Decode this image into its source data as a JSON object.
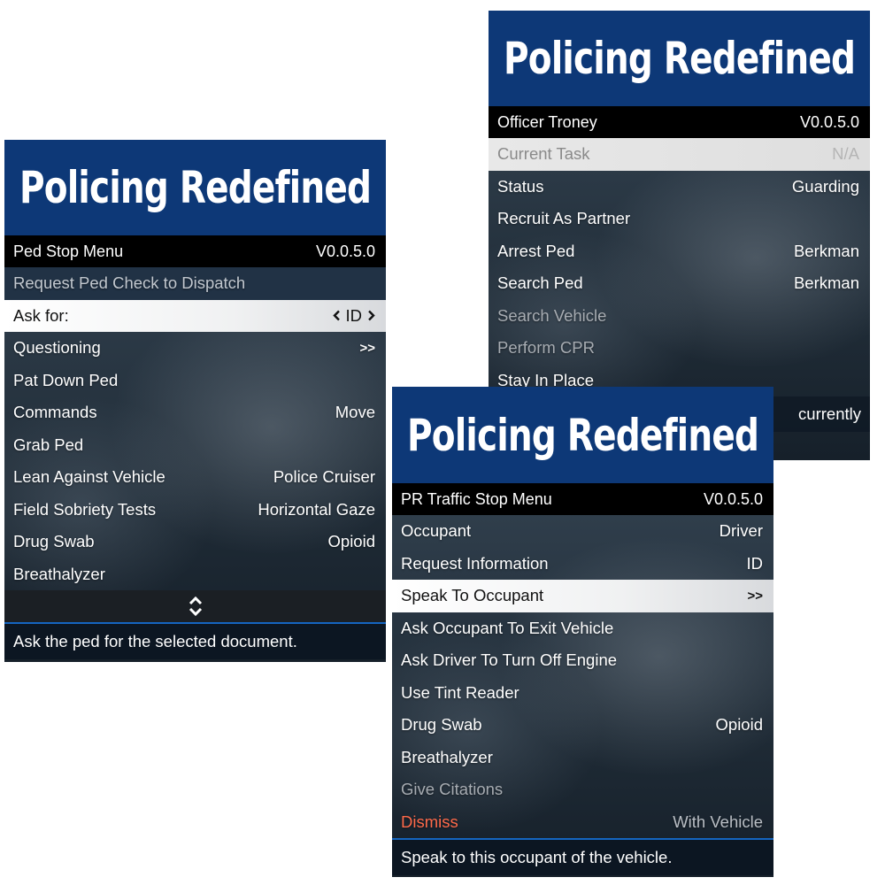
{
  "menu_a": {
    "banner": "Policing Redefined",
    "header": {
      "title": "Ped Stop Menu",
      "version": "V0.0.5.0"
    },
    "items": [
      {
        "label": "Request Ped Check to Dispatch",
        "value": "",
        "state": "dim-dark"
      },
      {
        "label": "Ask for:",
        "value": "ID",
        "state": "selected"
      },
      {
        "label": "Questioning",
        "value": ">>",
        "state": "normal"
      },
      {
        "label": "Pat Down Ped",
        "value": "",
        "state": "normal"
      },
      {
        "label": "Commands",
        "value": "Move",
        "state": "normal"
      },
      {
        "label": "Grab Ped",
        "value": "",
        "state": "normal"
      },
      {
        "label": "Lean Against Vehicle",
        "value": "Police Cruiser",
        "state": "normal"
      },
      {
        "label": "Field Sobriety Tests",
        "value": "Horizontal Gaze",
        "state": "normal"
      },
      {
        "label": "Drug Swab",
        "value": "Opioid",
        "state": "normal"
      },
      {
        "label": "Breathalyzer",
        "value": "",
        "state": "normal"
      }
    ],
    "scroll_icon": "up-down-chevron-icon",
    "description": "Ask the ped for the selected document."
  },
  "menu_b": {
    "banner": "Policing Redefined",
    "header": {
      "title": "Officer Troney",
      "version": "V0.0.5.0"
    },
    "items": [
      {
        "label": "Current Task",
        "value": "N/A",
        "state": "selected-grey"
      },
      {
        "label": "Status",
        "value": "Guarding",
        "state": "normal"
      },
      {
        "label": "Recruit As Partner",
        "value": "",
        "state": "normal"
      },
      {
        "label": "Arrest Ped",
        "value": "Berkman",
        "state": "normal"
      },
      {
        "label": "Search Ped",
        "value": "Berkman",
        "state": "normal"
      },
      {
        "label": "Search Vehicle",
        "value": "",
        "state": "dim"
      },
      {
        "label": "Perform CPR",
        "value": "",
        "state": "dim"
      },
      {
        "label": "Stay In Place",
        "value": "",
        "state": "normal"
      }
    ],
    "footer_partial": "currently"
  },
  "menu_c": {
    "banner": "Policing Redefined",
    "header": {
      "title": "PR Traffic Stop Menu",
      "version": "V0.0.5.0"
    },
    "items": [
      {
        "label": "Occupant",
        "value": "Driver",
        "state": "normal"
      },
      {
        "label": "Request Information",
        "value": "ID",
        "state": "normal"
      },
      {
        "label": "Speak To Occupant",
        "value": ">>",
        "state": "selected"
      },
      {
        "label": "Ask Occupant To Exit Vehicle",
        "value": "",
        "state": "normal"
      },
      {
        "label": "Ask Driver To Turn Off Engine",
        "value": "",
        "state": "normal"
      },
      {
        "label": "Use Tint Reader",
        "value": "",
        "state": "normal"
      },
      {
        "label": "Drug Swab",
        "value": "Opioid",
        "state": "normal"
      },
      {
        "label": "Breathalyzer",
        "value": "",
        "state": "normal"
      },
      {
        "label": "Give Citations",
        "value": "",
        "state": "dim"
      },
      {
        "label": "Dismiss",
        "value": "With Vehicle",
        "state": "danger"
      }
    ],
    "description": "Speak to this occupant of the vehicle."
  },
  "colors": {
    "banner": "#0d3877",
    "header": "#000000",
    "danger": "#ff6a4a",
    "accent_line": "#1565c0"
  }
}
